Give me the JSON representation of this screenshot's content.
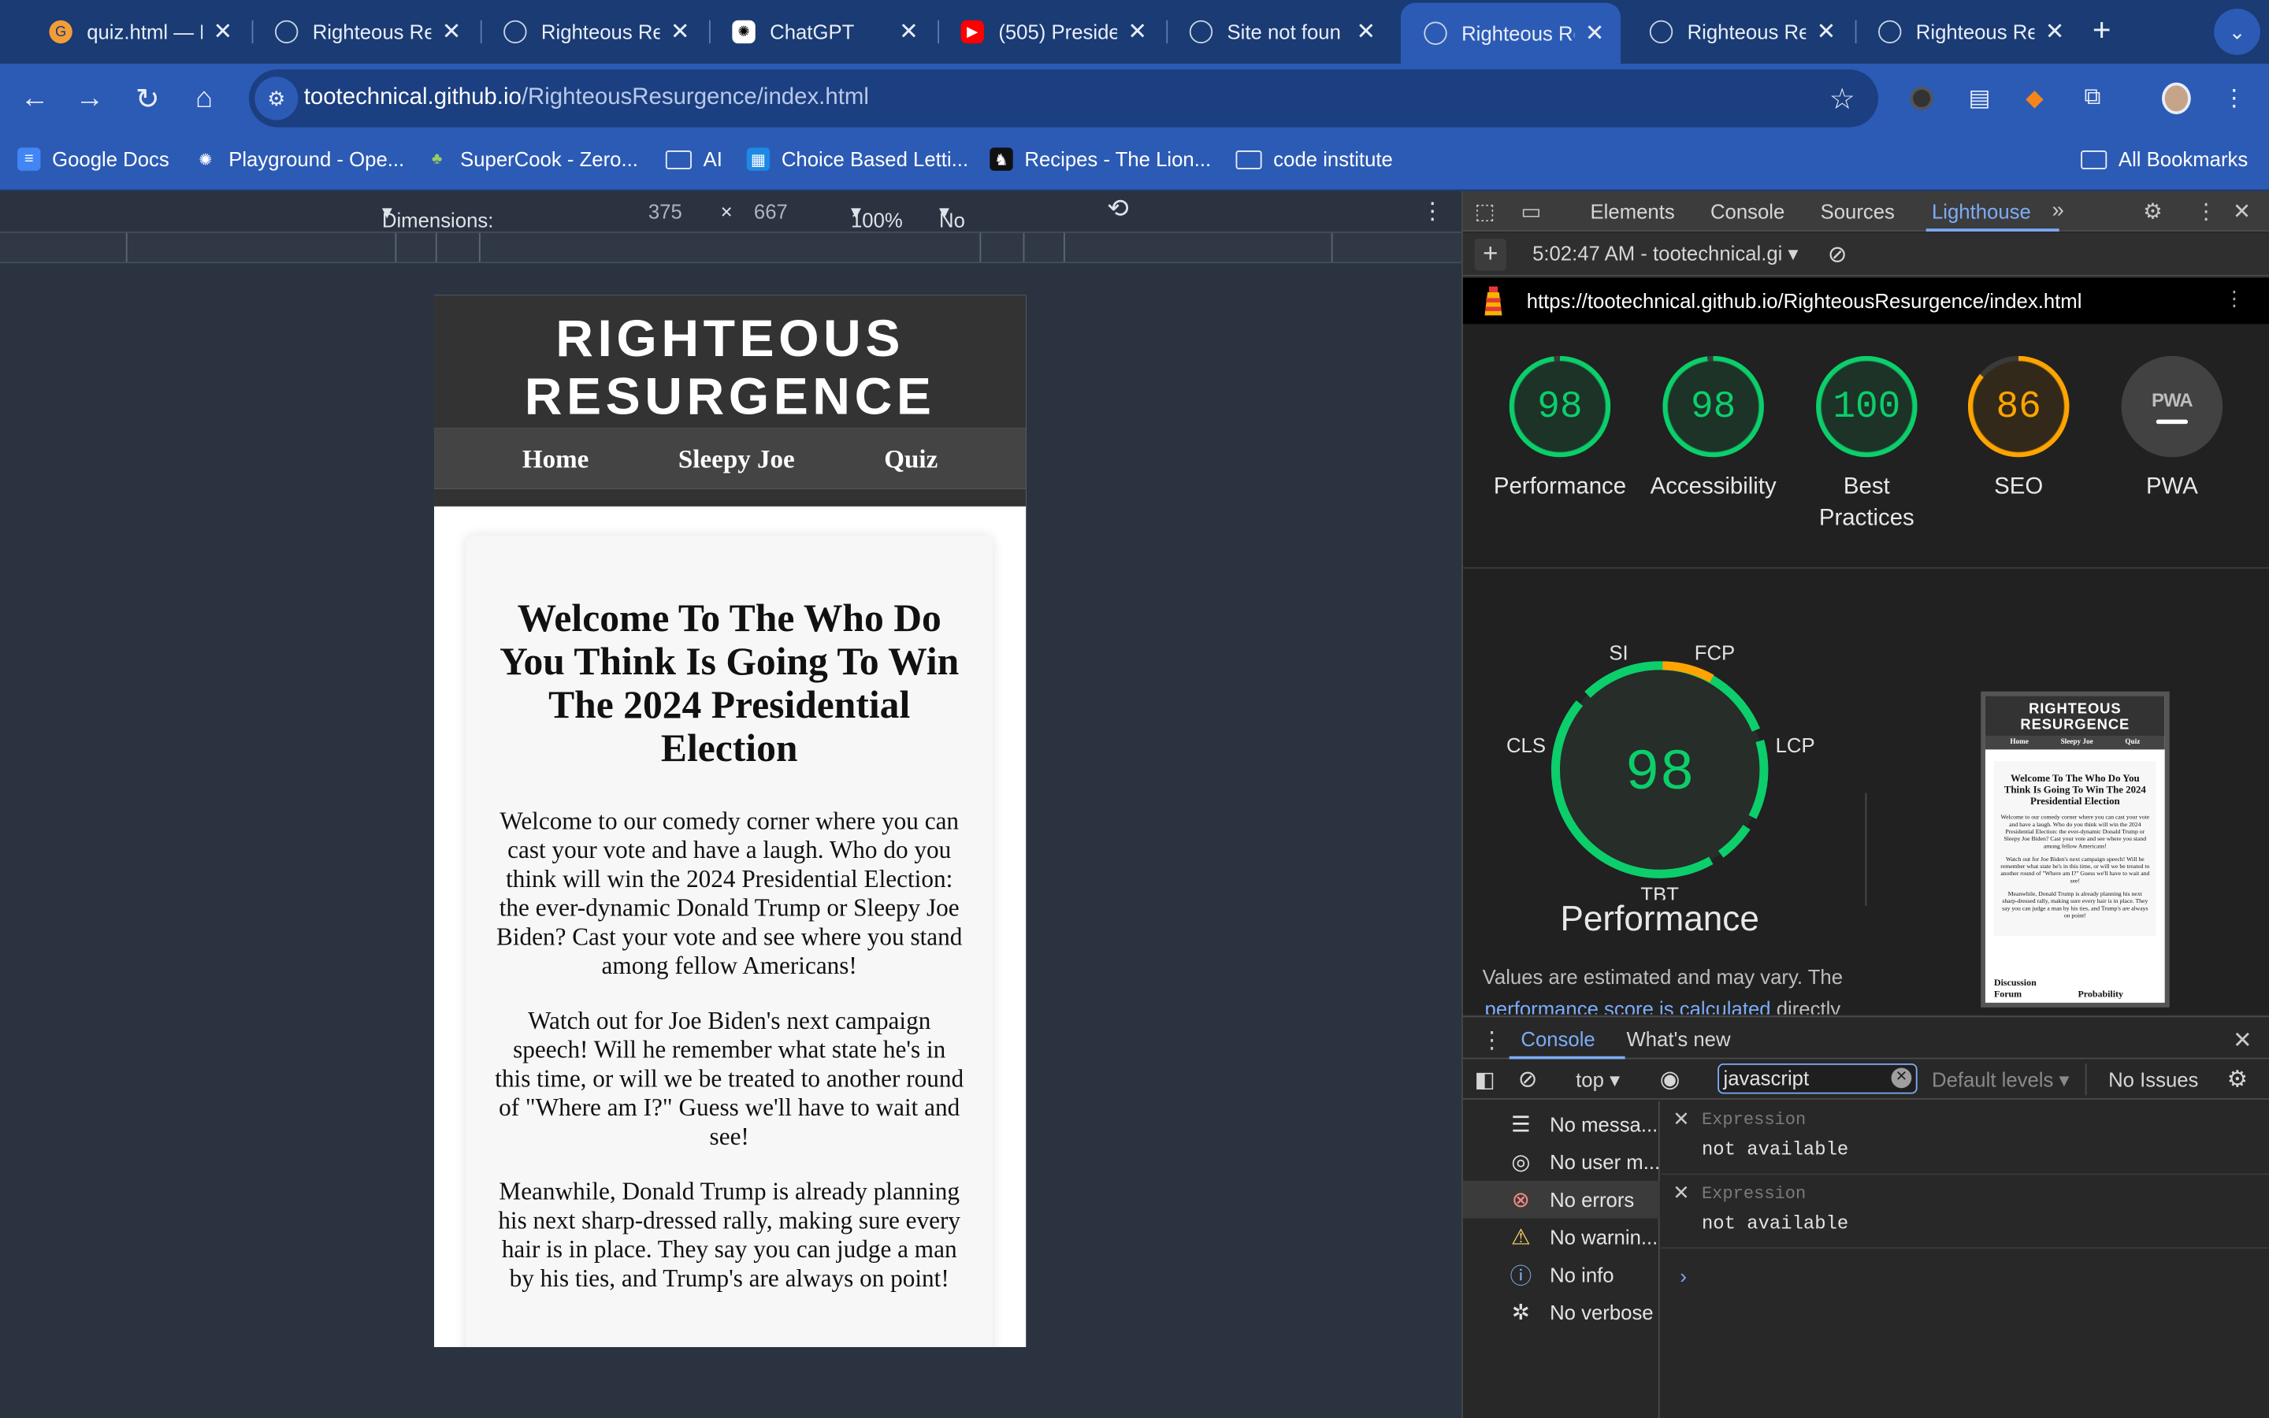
{
  "browser": {
    "tabs": [
      {
        "title": "quiz.html — R",
        "icon": "gitpod-icon",
        "color": "#f29d38"
      },
      {
        "title": "Righteous Re",
        "icon": "globe-icon",
        "color": "#c9d4e8"
      },
      {
        "title": "Righteous Re",
        "icon": "globe-icon",
        "color": "#c9d4e8"
      },
      {
        "title": "ChatGPT",
        "icon": "chatgpt-icon",
        "color": "#ffffff"
      },
      {
        "title": "(505) Preside",
        "icon": "youtube-icon",
        "color": "#ff0000"
      },
      {
        "title": "Site not foun",
        "icon": "globe-icon",
        "color": "#c9d4e8"
      },
      {
        "title": "Righteous Re",
        "icon": "globe-icon",
        "color": "#c9d4e8",
        "active": true
      },
      {
        "title": "Righteous Re",
        "icon": "globe-icon",
        "color": "#c9d4e8"
      },
      {
        "title": "Righteous Re",
        "icon": "globe-icon",
        "color": "#c9d4e8"
      }
    ],
    "address": {
      "host": "tootechnical.github.io",
      "path": "/RighteousResurgence/index.html"
    },
    "bookmarks": [
      {
        "label": "Google Docs",
        "icon": "docs-icon"
      },
      {
        "label": "Playground - Ope...",
        "icon": "openai-icon"
      },
      {
        "label": "SuperCook - Zero...",
        "icon": "supercook-icon"
      },
      {
        "label": "AI",
        "icon": "folder-icon"
      },
      {
        "label": "Choice Based Letti...",
        "icon": "choice-icon"
      },
      {
        "label": "Recipes - The Lion...",
        "icon": "lion-icon"
      },
      {
        "label": "code institute",
        "icon": "folder-icon"
      }
    ],
    "all_bookmarks": "All Bookmarks"
  },
  "device_toolbar": {
    "dimensions_label": "Dimensions: iPhone SE",
    "width": "375",
    "times": "×",
    "height": "667",
    "zoom": "100%",
    "throttling": "No throttling"
  },
  "site": {
    "title_line1": "RIGHTEOUS",
    "title_line2": "RESURGENCE",
    "nav": [
      "Home",
      "Sleepy Joe",
      "Quiz"
    ],
    "heading": "Welcome To The Who Do You Think Is Going To Win The 2024 Presidential Election",
    "paragraphs": [
      "Welcome to our comedy corner where you can cast your vote and have a laugh. Who do you think will win the 2024 Presidential Election: the ever-dynamic Donald Trump or Sleepy Joe Biden? Cast your vote and see where you stand among fellow Americans!",
      "Watch out for Joe Biden's next campaign speech! Will he remember what state he's in this time, or will we be treated to another round of \"Where am I?\" Guess we'll have to wait and see!",
      "Meanwhile, Donald Trump is already planning his next sharp-dressed rally, making sure every hair is in place. They say you can judge a man by his ties, and Trump's are always on point!"
    ]
  },
  "devtools": {
    "tabs": [
      "Elements",
      "Console",
      "Sources",
      "Lighthouse"
    ],
    "active_tab": "Lighthouse",
    "report_time": "5:02:47 AM - tootechnical.gi",
    "report_url": "https://tootechnical.github.io/RighteousResurgence/index.html",
    "scores": [
      {
        "label": "Performance",
        "value": "98",
        "fraction": 0.98,
        "color": "#0cce6b"
      },
      {
        "label": "Accessibility",
        "value": "98",
        "fraction": 0.98,
        "color": "#0cce6b"
      },
      {
        "label": "Best Practices",
        "value": "100",
        "fraction": 1.0,
        "color": "#0cce6b"
      },
      {
        "label": "SEO",
        "value": "86",
        "fraction": 0.86,
        "color": "#ffa400"
      },
      {
        "label": "PWA",
        "value": "PWA",
        "color": "#9e9e9e"
      }
    ],
    "perf_gauge": {
      "score": "98",
      "metrics": [
        "SI",
        "FCP",
        "LCP",
        "TBT",
        "CLS"
      ],
      "title": "Performance",
      "note_before": "Values are estimated and may vary. The",
      "note_link": "performance score is calculated",
      "note_after": "directly from"
    },
    "thumbnail": {
      "title_line1": "RIGHTEOUS",
      "title_line2": "RESURGENCE",
      "nav": [
        "Home",
        "Sleepy Joe",
        "Quiz"
      ],
      "footer_left_line1": "Discussion",
      "footer_left_line2": "Forum",
      "footer_right": "Probability"
    },
    "drawer_tabs": [
      "Console",
      "What's new"
    ],
    "console": {
      "context": "top",
      "filter": "javascript",
      "levels": "Default levels",
      "issues": "No Issues",
      "sidebar": [
        {
          "label": "No messa...",
          "icon": "list-icon"
        },
        {
          "label": "No user m...",
          "icon": "user-icon"
        },
        {
          "label": "No errors",
          "icon": "error-icon"
        },
        {
          "label": "No warnin...",
          "icon": "warning-icon"
        },
        {
          "label": "No info",
          "icon": "info-icon"
        },
        {
          "label": "No verbose",
          "icon": "bug-icon"
        }
      ],
      "expressions": [
        {
          "key": "Expression",
          "value": "not available"
        },
        {
          "key": "Expression",
          "value": "not available"
        }
      ]
    }
  }
}
